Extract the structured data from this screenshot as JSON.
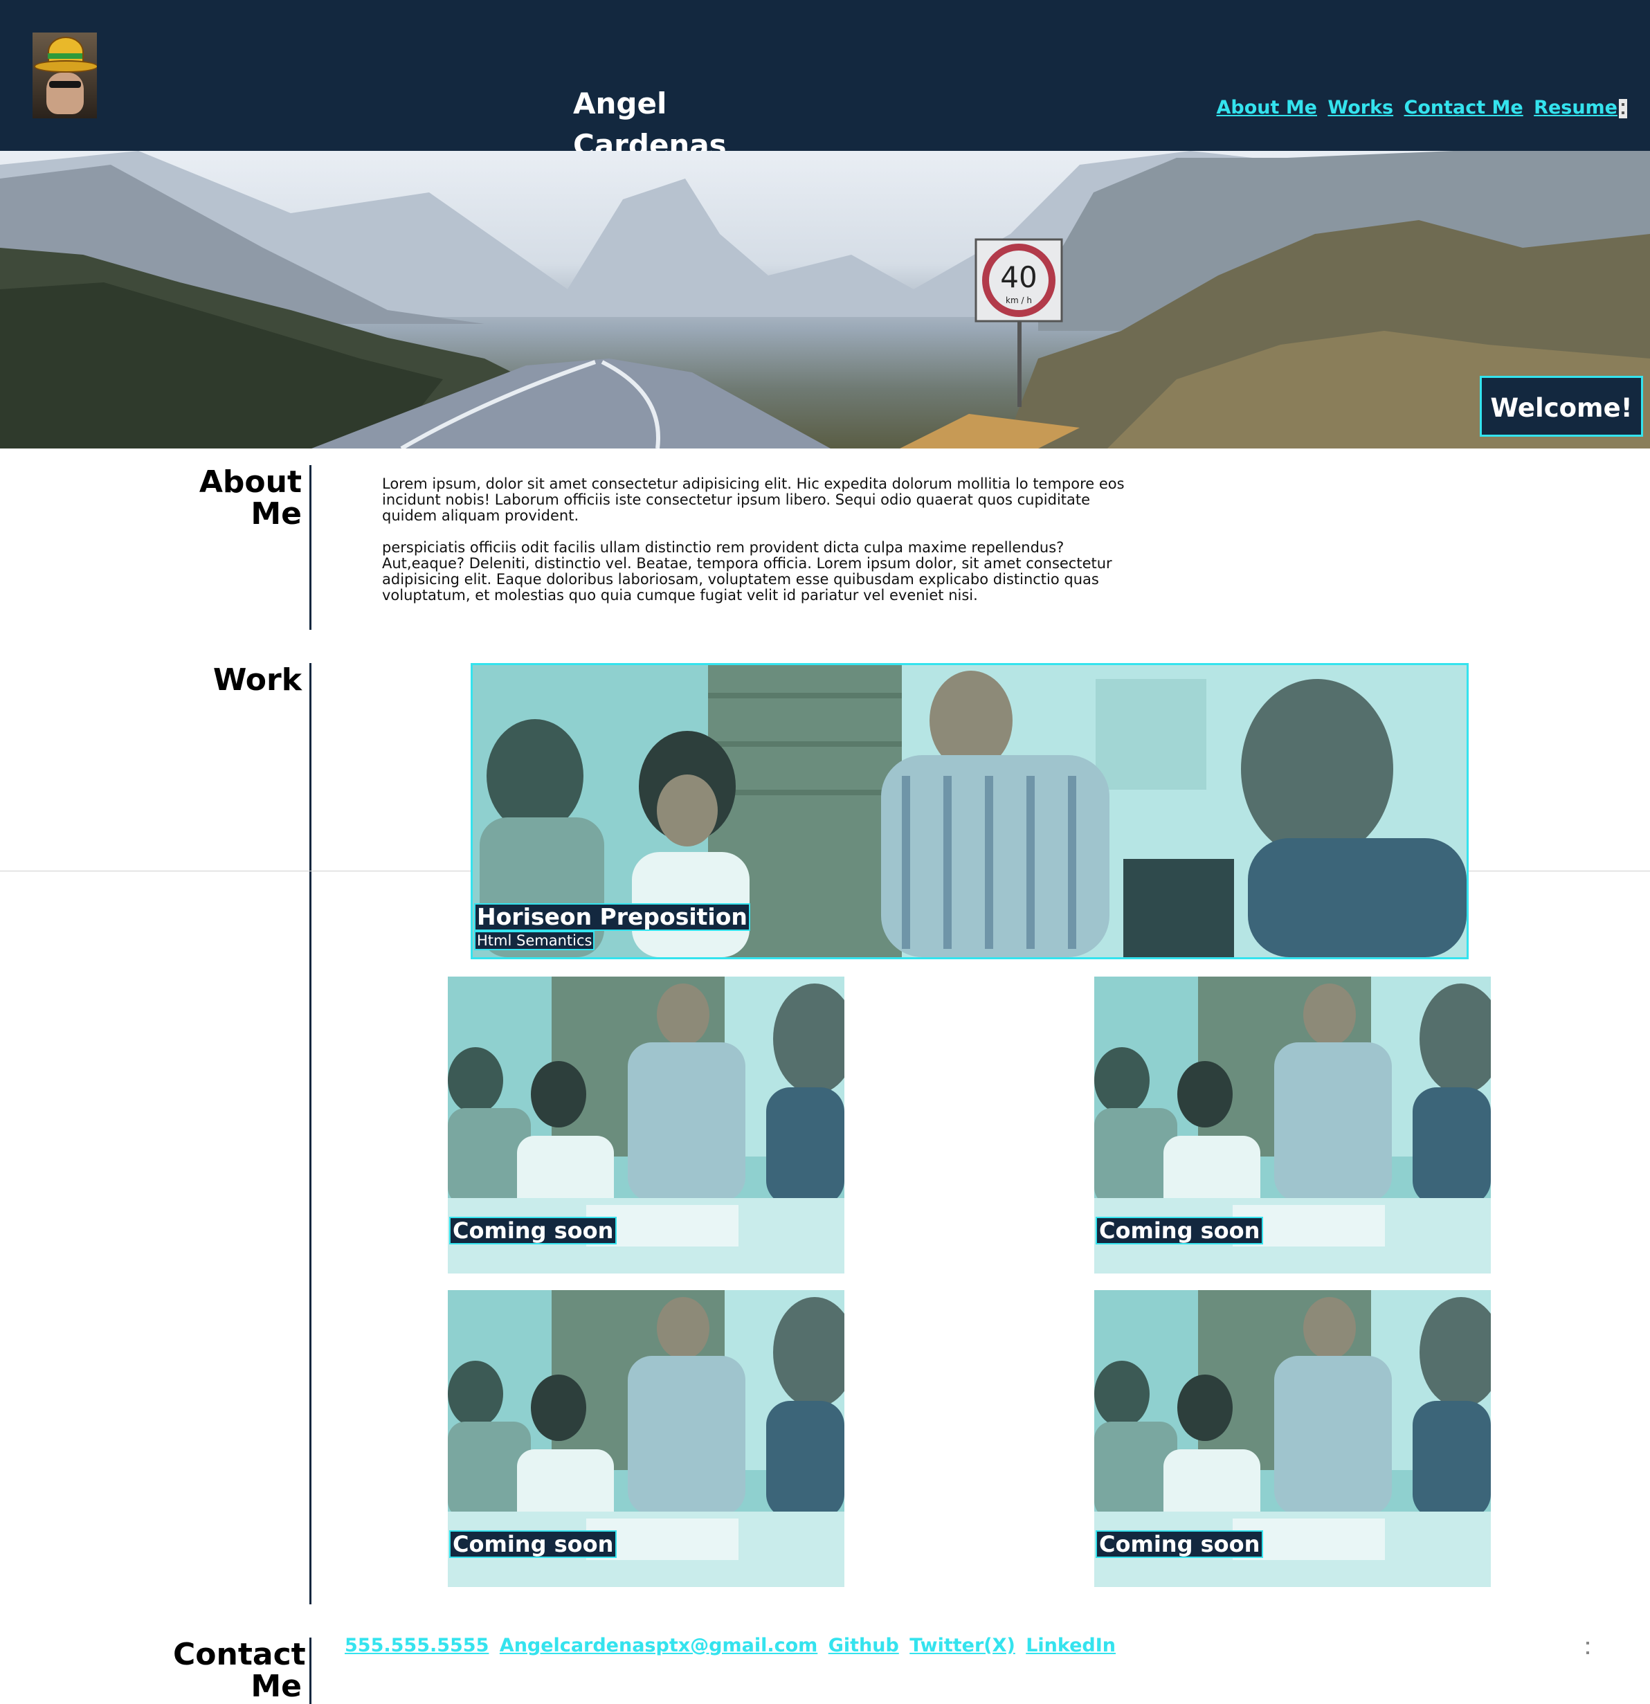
{
  "header": {
    "title": "Angel Cardenas",
    "nav": [
      "About Me",
      "Works",
      "Contact Me",
      "Resume"
    ]
  },
  "hero": {
    "welcome": "Welcome!",
    "sign_value": "40",
    "sign_unit": "km / h"
  },
  "about": {
    "heading": "About Me",
    "paragraphs": [
      "Lorem ipsum, dolor sit amet consectetur adipisicing elit. Hic expedita dolorum mollitia lo tempore eos incidunt nobis! Laborum officiis iste consectetur ipsum libero. Sequi odio quaerat quos cupiditate quidem aliquam provident.",
      "perspiciatis officiis odit facilis ullam distinctio rem provident dicta culpa maxime repellendus? Aut,eaque? Deleniti, distinctio vel. Beatae, tempora officia. Lorem ipsum dolor, sit amet consectetur adipisicing elit. Eaque doloribus laboriosam, voluptatem esse quibusdam explicabo distinctio quas voluptatum, et molestias quo quia cumque fugiat velit id pariatur vel eveniet nisi."
    ]
  },
  "work": {
    "heading": "Work",
    "featured": {
      "title": "Horiseon Preposition",
      "subtitle": "Html Semantics"
    },
    "cards": [
      "Coming soon",
      "Coming soon",
      "Coming soon",
      "Coming soon"
    ]
  },
  "contact": {
    "heading": "Contact Me",
    "links": [
      "555.555.5555",
      "Angelcardenasptx@gmail.com",
      "Github",
      "Twitter(X)",
      "LinkedIn"
    ]
  },
  "colors": {
    "header_bg": "#13283f",
    "accent": "#34e3ee",
    "text": "#000000",
    "photo_tint": "#7fd6d6"
  }
}
